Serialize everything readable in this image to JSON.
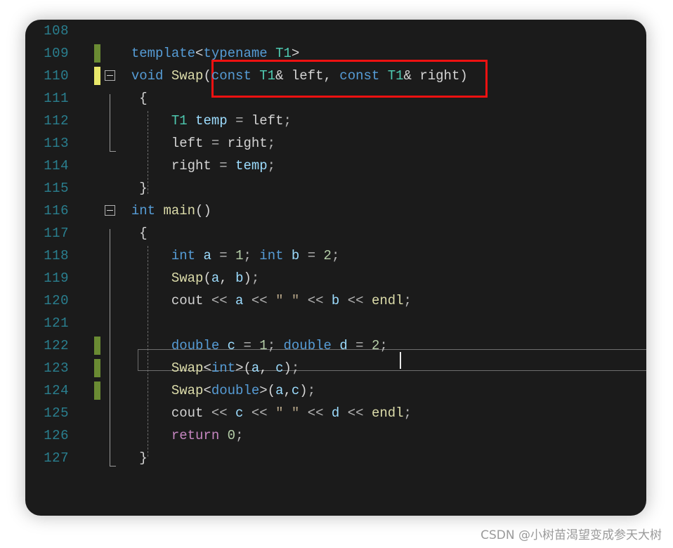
{
  "editor": {
    "theme": "dark",
    "background": "#1b1b1b",
    "language": "C++",
    "first_line": 108,
    "last_line": 127,
    "current_line": 122,
    "colors": {
      "keyword": "#569cd6",
      "type": "#4ec9b0",
      "function": "#dcdcaa",
      "variable": "#9cdcfe",
      "number": "#b5cea8",
      "control": "#c586c0",
      "string": "#b9a88a",
      "plain": "#d4d4d4",
      "line_number": "#2a7f8f",
      "annotation": "#ee1111",
      "change_saved": "#6a8b33",
      "change_unsaved": "#e8e86a"
    }
  },
  "lines": [
    {
      "number": "108",
      "tokens": []
    },
    {
      "number": "109",
      "tokens": [
        {
          "t": "  ",
          "c": "pl"
        },
        {
          "t": "template",
          "c": "kw"
        },
        {
          "t": "<",
          "c": "pl"
        },
        {
          "t": "typename",
          "c": "kw"
        },
        {
          "t": " ",
          "c": "pl"
        },
        {
          "t": "T1",
          "c": "typ"
        },
        {
          "t": ">",
          "c": "pl"
        }
      ]
    },
    {
      "number": "110",
      "tokens": [
        {
          "t": "  ",
          "c": "pl"
        },
        {
          "t": "void",
          "c": "kw"
        },
        {
          "t": " ",
          "c": "pl"
        },
        {
          "t": "Swap",
          "c": "fn"
        },
        {
          "t": "(",
          "c": "pl"
        },
        {
          "t": "const",
          "c": "kw"
        },
        {
          "t": " ",
          "c": "pl"
        },
        {
          "t": "T1",
          "c": "typ"
        },
        {
          "t": "& left, ",
          "c": "pl"
        },
        {
          "t": "const",
          "c": "kw"
        },
        {
          "t": " ",
          "c": "pl"
        },
        {
          "t": "T1",
          "c": "typ"
        },
        {
          "t": "& right)",
          "c": "pl"
        }
      ]
    },
    {
      "number": "111",
      "tokens": [
        {
          "t": "   {",
          "c": "pl"
        }
      ]
    },
    {
      "number": "112",
      "tokens": [
        {
          "t": "       ",
          "c": "pl"
        },
        {
          "t": "T1",
          "c": "typ"
        },
        {
          "t": " ",
          "c": "pl"
        },
        {
          "t": "temp",
          "c": "var"
        },
        {
          "t": " ",
          "c": "pl"
        },
        {
          "t": "=",
          "c": "op"
        },
        {
          "t": " left",
          "c": "pl"
        },
        {
          "t": ";",
          "c": "op"
        }
      ]
    },
    {
      "number": "113",
      "tokens": [
        {
          "t": "       left ",
          "c": "pl"
        },
        {
          "t": "=",
          "c": "op"
        },
        {
          "t": " right",
          "c": "pl"
        },
        {
          "t": ";",
          "c": "op"
        }
      ]
    },
    {
      "number": "114",
      "tokens": [
        {
          "t": "       right ",
          "c": "pl"
        },
        {
          "t": "=",
          "c": "op"
        },
        {
          "t": " ",
          "c": "pl"
        },
        {
          "t": "temp",
          "c": "var"
        },
        {
          "t": ";",
          "c": "op"
        }
      ]
    },
    {
      "number": "115",
      "tokens": [
        {
          "t": "   }",
          "c": "pl"
        }
      ]
    },
    {
      "number": "116",
      "tokens": [
        {
          "t": "  ",
          "c": "pl"
        },
        {
          "t": "int",
          "c": "kw"
        },
        {
          "t": " ",
          "c": "pl"
        },
        {
          "t": "main",
          "c": "fn"
        },
        {
          "t": "()",
          "c": "pl"
        }
      ]
    },
    {
      "number": "117",
      "tokens": [
        {
          "t": "   {",
          "c": "pl"
        }
      ]
    },
    {
      "number": "118",
      "tokens": [
        {
          "t": "       ",
          "c": "pl"
        },
        {
          "t": "int",
          "c": "kw"
        },
        {
          "t": " ",
          "c": "pl"
        },
        {
          "t": "a",
          "c": "var"
        },
        {
          "t": " ",
          "c": "pl"
        },
        {
          "t": "=",
          "c": "op"
        },
        {
          "t": " ",
          "c": "pl"
        },
        {
          "t": "1",
          "c": "num"
        },
        {
          "t": "; ",
          "c": "op"
        },
        {
          "t": "int",
          "c": "kw"
        },
        {
          "t": " ",
          "c": "pl"
        },
        {
          "t": "b",
          "c": "var"
        },
        {
          "t": " ",
          "c": "pl"
        },
        {
          "t": "=",
          "c": "op"
        },
        {
          "t": " ",
          "c": "pl"
        },
        {
          "t": "2",
          "c": "num"
        },
        {
          "t": ";",
          "c": "op"
        }
      ]
    },
    {
      "number": "119",
      "tokens": [
        {
          "t": "       ",
          "c": "pl"
        },
        {
          "t": "Swap",
          "c": "fn"
        },
        {
          "t": "(",
          "c": "pl"
        },
        {
          "t": "a",
          "c": "var"
        },
        {
          "t": ", ",
          "c": "pl"
        },
        {
          "t": "b",
          "c": "var"
        },
        {
          "t": ")",
          "c": "pl"
        },
        {
          "t": ";",
          "c": "op"
        }
      ]
    },
    {
      "number": "120",
      "tokens": [
        {
          "t": "       cout ",
          "c": "pl"
        },
        {
          "t": "<<",
          "c": "op"
        },
        {
          "t": " ",
          "c": "pl"
        },
        {
          "t": "a",
          "c": "var"
        },
        {
          "t": " ",
          "c": "pl"
        },
        {
          "t": "<<",
          "c": "op"
        },
        {
          "t": " \" \" ",
          "c": "str"
        },
        {
          "t": "<<",
          "c": "op"
        },
        {
          "t": " ",
          "c": "pl"
        },
        {
          "t": "b",
          "c": "var"
        },
        {
          "t": " ",
          "c": "pl"
        },
        {
          "t": "<<",
          "c": "op"
        },
        {
          "t": " ",
          "c": "pl"
        },
        {
          "t": "endl",
          "c": "fn"
        },
        {
          "t": ";",
          "c": "op"
        }
      ]
    },
    {
      "number": "121",
      "tokens": []
    },
    {
      "number": "122",
      "tokens": [
        {
          "t": "       ",
          "c": "pl"
        },
        {
          "t": "double",
          "c": "kw"
        },
        {
          "t": " ",
          "c": "pl"
        },
        {
          "t": "c",
          "c": "var"
        },
        {
          "t": " ",
          "c": "pl"
        },
        {
          "t": "=",
          "c": "op"
        },
        {
          "t": " ",
          "c": "pl"
        },
        {
          "t": "1",
          "c": "num"
        },
        {
          "t": "; ",
          "c": "op"
        },
        {
          "t": "double",
          "c": "kw"
        },
        {
          "t": " ",
          "c": "pl"
        },
        {
          "t": "d",
          "c": "var"
        },
        {
          "t": " ",
          "c": "pl"
        },
        {
          "t": "=",
          "c": "op"
        },
        {
          "t": " ",
          "c": "pl"
        },
        {
          "t": "2",
          "c": "num"
        },
        {
          "t": ";",
          "c": "op"
        }
      ]
    },
    {
      "number": "123",
      "tokens": [
        {
          "t": "       ",
          "c": "pl"
        },
        {
          "t": "Swap",
          "c": "fn"
        },
        {
          "t": "<",
          "c": "pl"
        },
        {
          "t": "int",
          "c": "kw"
        },
        {
          "t": ">(",
          "c": "pl"
        },
        {
          "t": "a",
          "c": "var"
        },
        {
          "t": ", ",
          "c": "pl"
        },
        {
          "t": "c",
          "c": "var"
        },
        {
          "t": ")",
          "c": "pl"
        },
        {
          "t": ";",
          "c": "op"
        }
      ]
    },
    {
      "number": "124",
      "tokens": [
        {
          "t": "       ",
          "c": "pl"
        },
        {
          "t": "Swap",
          "c": "fn"
        },
        {
          "t": "<",
          "c": "pl"
        },
        {
          "t": "double",
          "c": "kw"
        },
        {
          "t": ">(",
          "c": "pl"
        },
        {
          "t": "a",
          "c": "var"
        },
        {
          "t": ",",
          "c": "pl"
        },
        {
          "t": "c",
          "c": "var"
        },
        {
          "t": ")",
          "c": "pl"
        },
        {
          "t": ";",
          "c": "op"
        }
      ]
    },
    {
      "number": "125",
      "tokens": [
        {
          "t": "       cout ",
          "c": "pl"
        },
        {
          "t": "<<",
          "c": "op"
        },
        {
          "t": " ",
          "c": "pl"
        },
        {
          "t": "c",
          "c": "var"
        },
        {
          "t": " ",
          "c": "pl"
        },
        {
          "t": "<<",
          "c": "op"
        },
        {
          "t": " \" \" ",
          "c": "str"
        },
        {
          "t": "<<",
          "c": "op"
        },
        {
          "t": " ",
          "c": "pl"
        },
        {
          "t": "d",
          "c": "var"
        },
        {
          "t": " ",
          "c": "pl"
        },
        {
          "t": "<<",
          "c": "op"
        },
        {
          "t": " ",
          "c": "pl"
        },
        {
          "t": "endl",
          "c": "fn"
        },
        {
          "t": ";",
          "c": "op"
        }
      ]
    },
    {
      "number": "126",
      "tokens": [
        {
          "t": "       ",
          "c": "pl"
        },
        {
          "t": "return",
          "c": "ret"
        },
        {
          "t": " ",
          "c": "pl"
        },
        {
          "t": "0",
          "c": "num"
        },
        {
          "t": ";",
          "c": "op"
        }
      ]
    },
    {
      "number": "127",
      "tokens": [
        {
          "t": "   }",
          "c": "pl"
        }
      ]
    }
  ],
  "gutter": {
    "change_bars": [
      {
        "line": "109",
        "state": "saved"
      },
      {
        "line": "110",
        "state": "unsaved"
      },
      {
        "line": "122",
        "state": "saved"
      },
      {
        "line": "123",
        "state": "saved"
      },
      {
        "line": "124",
        "state": "saved"
      }
    ],
    "fold_markers": [
      {
        "line": "110",
        "state": "expanded"
      },
      {
        "line": "116",
        "state": "expanded"
      }
    ]
  },
  "annotation": {
    "shape": "rectangle",
    "color": "#ee1111",
    "encloses": "const T1& left, const T1& right)"
  },
  "watermark": {
    "text": "CSDN @小树苗渴望变成参天大树"
  }
}
